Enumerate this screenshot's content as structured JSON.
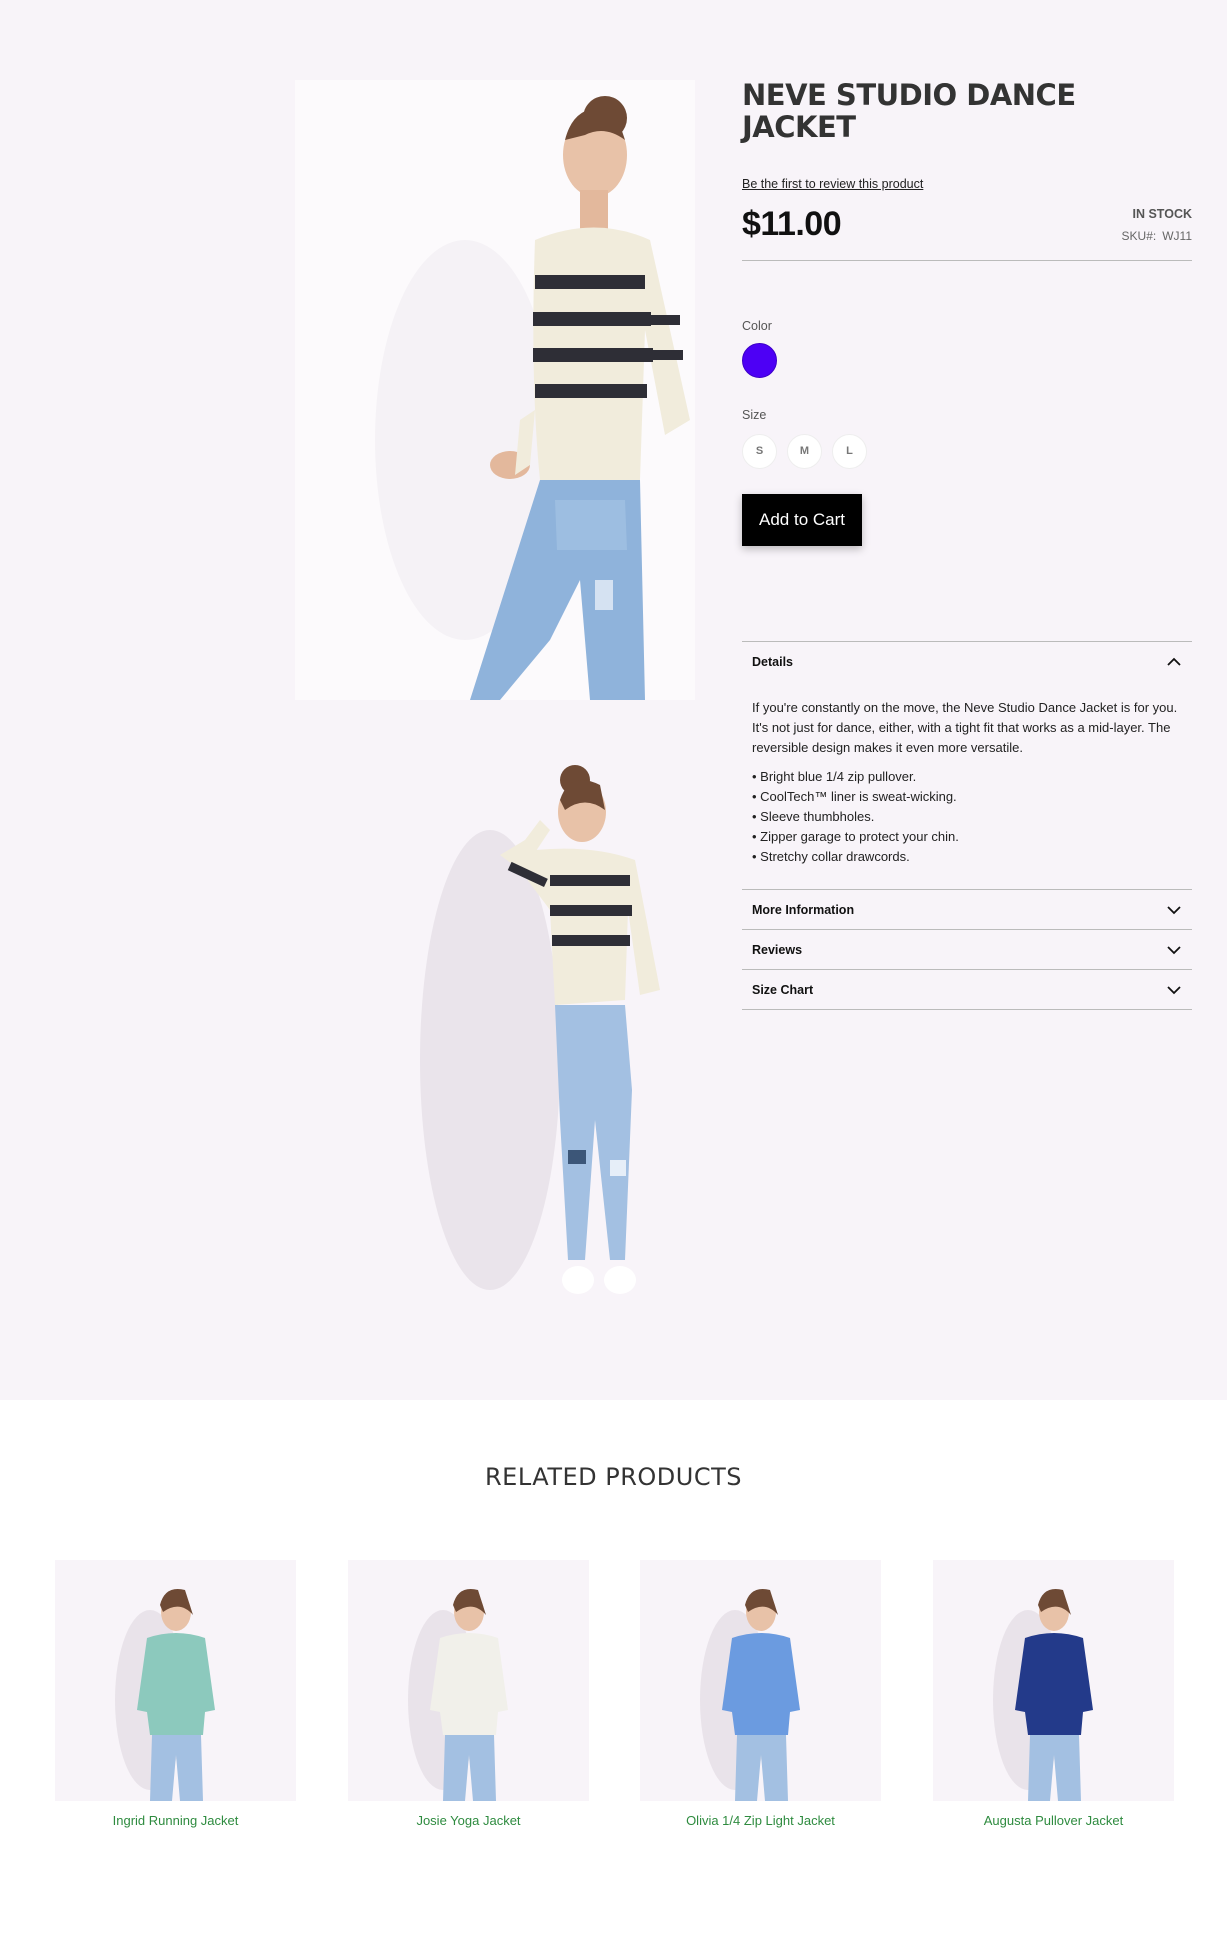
{
  "product": {
    "title": "NEVE STUDIO DANCE JACKET",
    "review_link": "Be the first to review this product",
    "price": "$11.00",
    "stock": "IN STOCK",
    "sku_label": "SKU#:",
    "sku_value": "WJ11"
  },
  "options": {
    "color_label": "Color",
    "color_swatch": "#4d00f5",
    "size_label": "Size",
    "sizes": [
      "S",
      "M",
      "L"
    ]
  },
  "add_to_cart_label": "Add to Cart",
  "accordion": {
    "details_title": "Details",
    "details_text": "If you're constantly on the move, the Neve Studio Dance Jacket is for you. It's not just for dance, either, with a tight fit that works as a mid-layer. The reversible design makes it even more versatile.",
    "bullets": [
      "• Bright blue 1/4 zip pullover.",
      "• CoolTech™ liner is sweat-wicking.",
      "• Sleeve thumbholes.",
      "• Zipper garage to protect your chin.",
      "• Stretchy collar drawcords."
    ],
    "more_info_title": "More Information",
    "reviews_title": "Reviews",
    "size_chart_title": "Size Chart"
  },
  "related": {
    "title": "RELATED PRODUCTS",
    "items": [
      {
        "name": "Ingrid Running Jacket",
        "top_color": "#8cc9bd"
      },
      {
        "name": "Josie Yoga Jacket",
        "top_color": "#f1f0ea"
      },
      {
        "name": "Olivia 1/4 Zip Light Jacket",
        "top_color": "#6b9be0"
      },
      {
        "name": "Augusta Pullover Jacket",
        "top_color": "#233a8a"
      }
    ]
  }
}
